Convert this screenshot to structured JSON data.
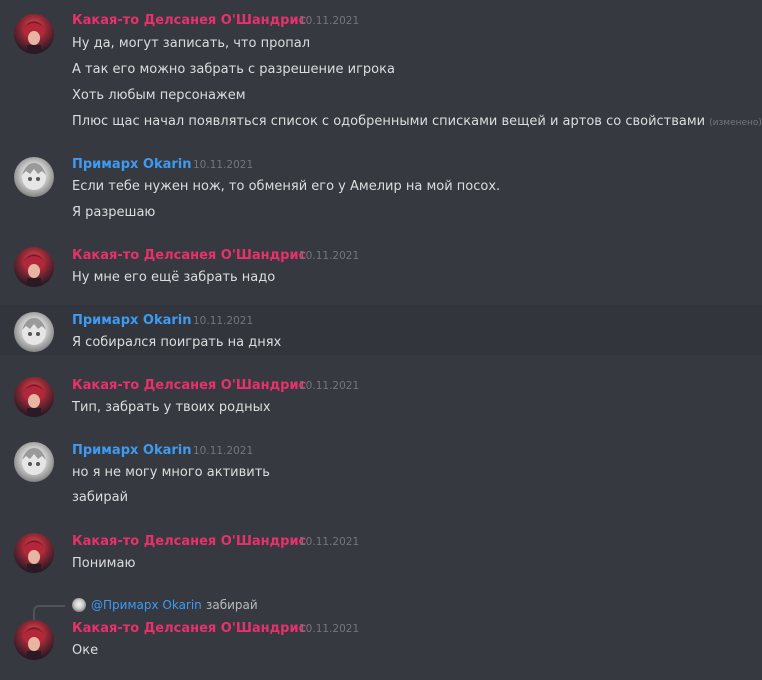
{
  "users": {
    "a": {
      "name": "Какая-то Делсанея О'Шандрис",
      "color": "#e8316b"
    },
    "b": {
      "name": "Примарх Okarin",
      "color": "#3f9af2"
    }
  },
  "messages": [
    {
      "author": "Какая-то Делсанея О'Шандрис",
      "timestamp": "10.11.2021",
      "lines": [
        "Ну да, могут записать, что пропал",
        "А так его можно забрать с разрешение игрока",
        "Хоть любым персонажем",
        "Плюс щас начал появляться список с одобренными списками вещей и артов со свойствами"
      ],
      "edited_label": "(изменено)"
    },
    {
      "author": "Примарх Okarin",
      "timestamp": "10.11.2021",
      "lines": [
        "Если тебе нужен нож, то обменяй его у Амелир на мой посох.",
        "Я разрешаю"
      ]
    },
    {
      "author": "Какая-то Делсанея О'Шандрис",
      "timestamp": "10.11.2021",
      "lines": [
        "Ну мне его ещё забрать надо"
      ]
    },
    {
      "author": "Примарх Okarin",
      "timestamp": "10.11.2021",
      "lines": [
        "Я собирался поиграть на днях"
      ]
    },
    {
      "author": "Какая-то Делсанея О'Шандрис",
      "timestamp": "10.11.2021",
      "lines": [
        "Тип, забрать у твоих родных"
      ]
    },
    {
      "author": "Примарх Okarin",
      "timestamp": "10.11.2021",
      "lines": [
        "но я не могу много активить",
        "забирай"
      ]
    },
    {
      "author": "Какая-то Делсанея О'Шандрис",
      "timestamp": "10.11.2021",
      "lines": [
        "Понимаю"
      ]
    },
    {
      "author": "Какая-то Делсанея О'Шандрис",
      "timestamp": "10.11.2021",
      "reply": {
        "mention": "@Примарх Okarin",
        "text": "забирай"
      },
      "lines": [
        "Оке"
      ]
    }
  ]
}
